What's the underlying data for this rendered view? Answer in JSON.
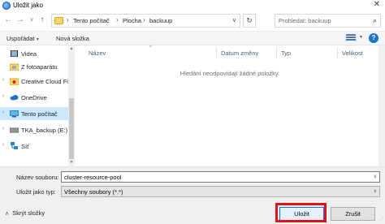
{
  "window": {
    "title": "Uložit jako",
    "close_glyph": "✕"
  },
  "nav": {
    "back_glyph": "←",
    "forward_glyph": "→",
    "dropdown_glyph": "∨",
    "up_glyph": "↑",
    "breadcrumb": [
      "Tento počítač",
      "Plocha",
      "backuup"
    ],
    "crumb_separator": "›",
    "refresh_glyph": "↻",
    "search_placeholder": "Prohledat: backuup",
    "search_glyph": "⌕"
  },
  "toolbar": {
    "organize_label": "Uspořádat",
    "organize_caret": "▾",
    "new_folder_label": "Nová složka",
    "help_glyph": "?"
  },
  "sidebar": {
    "items": [
      {
        "label": "Videa",
        "icon": "video-folder-icon"
      },
      {
        "label": "Z fotoaparátu",
        "icon": "camera-folder-icon"
      },
      {
        "label": "Creative Cloud Fi",
        "icon": "creative-cloud-icon"
      },
      {
        "label": "OneDrive",
        "icon": "cloud-icon"
      },
      {
        "label": "Tento počítač",
        "icon": "computer-icon"
      },
      {
        "label": "TKA_backup (E:)",
        "icon": "drive-icon"
      },
      {
        "label": "Síť",
        "icon": "network-icon"
      }
    ],
    "expand_glyph": "›"
  },
  "file_list": {
    "columns": [
      "Název",
      "Datum změny",
      "Typ",
      "Velikost"
    ],
    "sort_caret": "^",
    "empty_message": "Hledání neodpovídají žádné položky."
  },
  "form": {
    "filename_label": "Název souboru:",
    "filename_value": "cluster-resource-pool",
    "filetype_label": "Uložit jako typ:",
    "filetype_value": "Všechny soubory (*.*)",
    "dropdown_glyph": "∨"
  },
  "footer": {
    "hide_folders_label": "Skrýt složky",
    "hide_folders_caret": "∧",
    "save_label": "Uložit",
    "cancel_label": "Zrušit"
  },
  "colors": {
    "selection": "#cce8ff",
    "highlight_box": "#e0101f",
    "primary_button_border": "#0078d7"
  }
}
